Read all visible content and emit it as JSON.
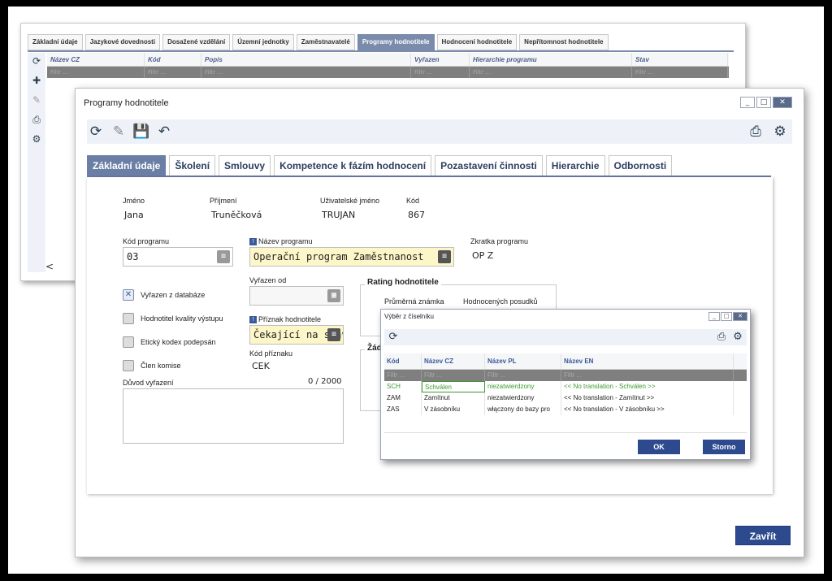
{
  "back_window": {
    "tabs": [
      "Základní údaje",
      "Jazykové dovednosti",
      "Dosažené vzdělání",
      "Územní jednotky",
      "Zaměstnavatelé",
      "Programy hodnotitele",
      "Hodnocení hodnotitele",
      "Nepřítomnost hodnotitele"
    ],
    "active_tab": "Programy hodnotitele",
    "columns": [
      "Název CZ",
      "Kód",
      "Popis",
      "Vyřazen",
      "Hierarchie programu",
      "Stav"
    ],
    "filter_placeholder": "Filtr ...",
    "scroll_indicator": "<"
  },
  "main_window": {
    "title": "Programy hodnotitele",
    "tabs": [
      "Základní údaje",
      "Školení",
      "Smlouvy",
      "Kompetence k fázím hodnocení",
      "Pozastavení činnosti",
      "Hierarchie",
      "Odbornosti"
    ],
    "active_tab": "Základní údaje",
    "person": {
      "jmeno_label": "Jméno",
      "jmeno": "Jana",
      "prijmeni_label": "Příjmení",
      "prijmeni": "Truněčková",
      "username_label": "Uživatelské jméno",
      "username": "TRUJAN",
      "kod_label": "Kód",
      "kod": "867"
    },
    "kod_programu_label": "Kód programu",
    "kod_programu": "03",
    "nazev_programu_label": "Název programu",
    "nazev_programu": "Operační program Zaměstnanost",
    "zkratka_label": "Zkratka programu",
    "zkratka": "OP Z",
    "checkboxes": [
      {
        "label": "Vyřazen z databáze",
        "checked": true
      },
      {
        "label": "Hodnotitel kvality výstupu",
        "checked": false
      },
      {
        "label": "Etický kodex podepsán",
        "checked": false
      },
      {
        "label": "Člen komise",
        "checked": false
      }
    ],
    "vyrazen_od_label": "Vyřazen od",
    "vyrazen_od": "",
    "priznak_label": "Příznak hodnotitele",
    "priznak": "Čekající na schv",
    "kod_priznaku_label": "Kód příznaku",
    "kod_priznaku": "CEK",
    "duvod_label": "Důvod vyřazení",
    "duvod_counter": "0 / 2000",
    "rating_title": "Rating hodnotitele",
    "rating_avg_label": "Průměrná známka",
    "rating_count_label": "Hodnocených posudků",
    "zad_partial": "Žád",
    "close_label": "Zavřít"
  },
  "dialog": {
    "title": "Výběr z číselníku",
    "columns": [
      "Kód",
      "Název CZ",
      "Název PL",
      "Název EN"
    ],
    "filter_placeholder": "Filtr ...",
    "rows": [
      {
        "kod": "SCH",
        "cz": "Schválen",
        "pl": "niezatwierdzony",
        "en": "<< No translation - Schválen >>",
        "selected": true
      },
      {
        "kod": "ZAM",
        "cz": "Zamítnut",
        "pl": "niezatwierdzony",
        "en": "<< No translation - Zamítnut >>",
        "selected": false
      },
      {
        "kod": "ZAS",
        "cz": "V zásobníku",
        "pl": "włączony do bazy pro",
        "en": "<< No translation - V zásobníku >>",
        "selected": false
      }
    ],
    "ok_label": "OK",
    "cancel_label": "Storno"
  },
  "colors": {
    "accent": "#6b7ea6",
    "required_bg": "#fdf6c9",
    "button": "#2e4a8e",
    "selected_row_text": "#3d9a2f"
  }
}
